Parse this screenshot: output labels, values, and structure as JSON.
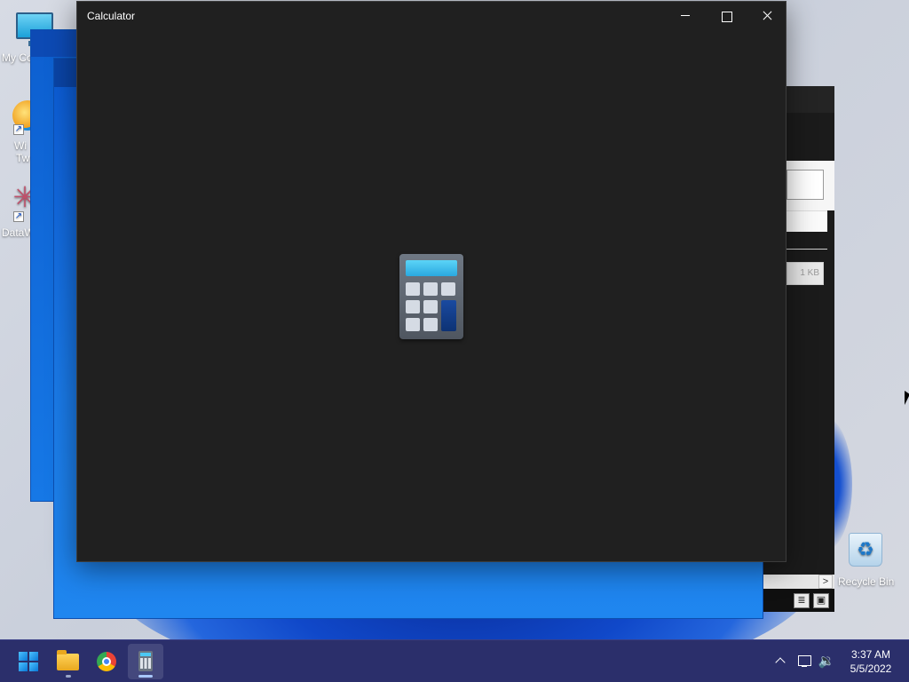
{
  "desktop": {
    "icons": [
      {
        "label": "My Co",
        "icon": "computer-icon"
      },
      {
        "label": "Wi",
        "label2": "Tw",
        "icon": "windows-twitter-icon"
      },
      {
        "label": "DataW",
        "icon": "data-icon"
      },
      {
        "label": "Recycle Bin",
        "icon": "recycle-bin-icon"
      }
    ]
  },
  "background_window": {
    "size_text": "1 KB",
    "scroll_arrow": ">"
  },
  "calculator": {
    "title": "Calculator",
    "controls": {
      "minimize": "",
      "maximize": "",
      "close": ""
    },
    "splash_icon": "calculator-icon"
  },
  "taskbar": {
    "apps": [
      {
        "name": "Start",
        "icon": "windows-start-icon"
      },
      {
        "name": "File Explorer",
        "icon": "folder-icon"
      },
      {
        "name": "Google Chrome",
        "icon": "chrome-icon"
      },
      {
        "name": "Calculator",
        "icon": "calculator-icon",
        "active": true
      }
    ],
    "tray": {
      "chevron": "",
      "network": "",
      "volume": "🔉"
    },
    "clock": {
      "time": "3:37 AM",
      "date": "5/5/2022"
    }
  },
  "colors": {
    "taskbar": "#2b2f6b",
    "calculator_bg": "#202020",
    "accent": "#0a78d7"
  }
}
